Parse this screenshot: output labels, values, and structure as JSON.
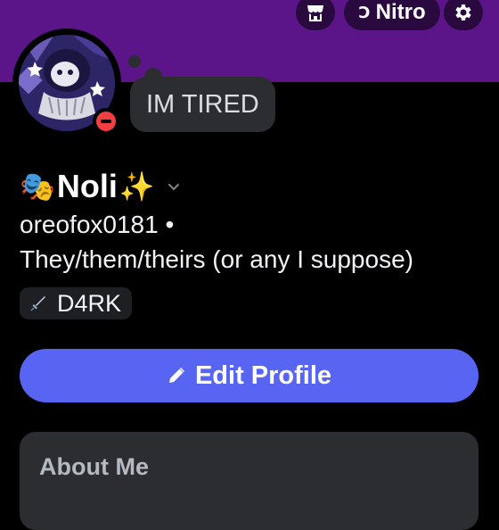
{
  "header": {
    "nitro_label": "Nitro",
    "icons": {
      "shop": "shop-icon",
      "nitro": "nitro-icon",
      "settings": "gear-icon"
    }
  },
  "profile": {
    "custom_status": "IM TIRED",
    "display_name": "Noli",
    "display_name_emoji_left": "🎭",
    "display_name_emoji_right": "✨",
    "username": "oreofox0181 •",
    "pronouns": "They/them/theirs (or any I suppose)",
    "tag": {
      "icon": "sword-icon",
      "label": "D4RK"
    },
    "status": "do-not-disturb"
  },
  "actions": {
    "edit_profile_label": "Edit Profile"
  },
  "about": {
    "title": "About Me"
  },
  "colors": {
    "banner": "#5b1589",
    "accent_button": "#5865f2",
    "dnd_status": "#f23f43",
    "card": "#2b2d31"
  }
}
